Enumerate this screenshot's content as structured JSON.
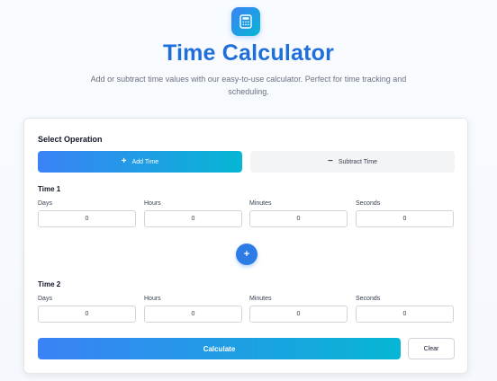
{
  "header": {
    "logo_icon": "calculator-icon",
    "title": "Time Calculator",
    "subtitle": "Add or subtract time values with our easy-to-use calculator. Perfect for time tracking and scheduling."
  },
  "operation": {
    "label": "Select Operation",
    "add": {
      "icon": "plus-icon",
      "glyph": "+",
      "label": "Add Time",
      "selected": true
    },
    "subtract": {
      "icon": "minus-icon",
      "glyph": "−",
      "label": "Subtract Time",
      "selected": false
    }
  },
  "time1": {
    "label": "Time 1",
    "fields": [
      {
        "label": "Days",
        "value": "0"
      },
      {
        "label": "Hours",
        "value": "0"
      },
      {
        "label": "Minutes",
        "value": "0"
      },
      {
        "label": "Seconds",
        "value": "0"
      }
    ]
  },
  "operator_indicator": {
    "icon": "plus-icon",
    "glyph": "+"
  },
  "time2": {
    "label": "Time 2",
    "fields": [
      {
        "label": "Days",
        "value": "0"
      },
      {
        "label": "Hours",
        "value": "0"
      },
      {
        "label": "Minutes",
        "value": "0"
      },
      {
        "label": "Seconds",
        "value": "0"
      }
    ]
  },
  "actions": {
    "calculate_label": "Calculate",
    "clear_label": "Clear"
  },
  "colors": {
    "accent_start": "#3b82f6",
    "accent_end": "#06b6d4",
    "title": "#1e6fd9"
  }
}
